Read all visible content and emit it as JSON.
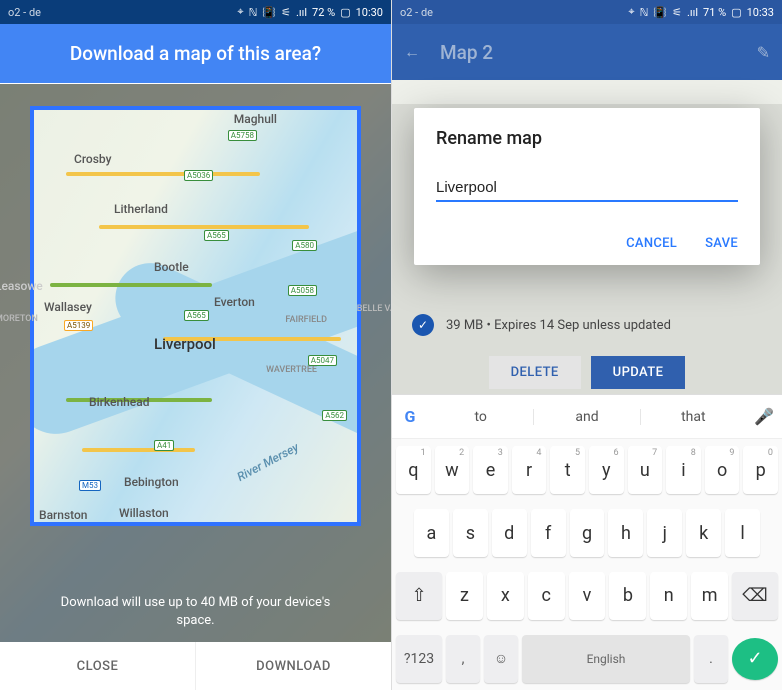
{
  "status": {
    "carrier": "o2 - de",
    "battery_left": "72 %",
    "time_left": "10:30",
    "battery_right": "71 %",
    "time_right": "10:33",
    "signal_text": ".ııl"
  },
  "left": {
    "title": "Download a map of this area?",
    "storage_msg": "Download will use up to 40 MB of your device's space.",
    "close_label": "CLOSE",
    "download_label": "DOWNLOAD",
    "places": {
      "maghull": "Maghull",
      "crosby": "Crosby",
      "litherland": "Litherland",
      "bootle": "Bootle",
      "wallasey": "Wallasey",
      "everton": "Everton",
      "fairfield": "FAIRFIELD",
      "liverpool": "Liverpool",
      "wavertree": "WAVERTREE",
      "birkenhead": "Birkenhead",
      "moreton": "MORETON",
      "bebington": "Bebington",
      "barnston": "Barnston",
      "willaston": "Willaston",
      "mersey": "River Mersey",
      "belleva": "BELLE VA",
      "leasowe": "Leasowe"
    },
    "shields": {
      "a5758": "A5758",
      "a5036": "A5036",
      "a565": "A565",
      "a580": "A580",
      "a5139": "A5139",
      "a565b": "A565",
      "a5058": "A5058",
      "a5047": "A5047",
      "a562": "A562",
      "a41": "A41",
      "m53": "M53"
    }
  },
  "right": {
    "appbar_title": "Map 2",
    "dialog_title": "Rename map",
    "input_value": "Liverpool",
    "cancel_label": "CANCEL",
    "save_label": "SAVE",
    "info_text": "39 MB • Expires 14 Sep unless updated",
    "delete_label": "DELETE",
    "update_label": "UPDATE",
    "suggestions": [
      "to",
      "and",
      "that"
    ],
    "row1": [
      {
        "k": "q",
        "s": "1"
      },
      {
        "k": "w",
        "s": "2"
      },
      {
        "k": "e",
        "s": "3"
      },
      {
        "k": "r",
        "s": "4"
      },
      {
        "k": "t",
        "s": "5"
      },
      {
        "k": "y",
        "s": "6"
      },
      {
        "k": "u",
        "s": "7"
      },
      {
        "k": "i",
        "s": "8"
      },
      {
        "k": "o",
        "s": "9"
      },
      {
        "k": "p",
        "s": "0"
      }
    ],
    "row2": [
      "a",
      "s",
      "d",
      "f",
      "g",
      "h",
      "j",
      "k",
      "l"
    ],
    "row3": [
      "z",
      "x",
      "c",
      "v",
      "b",
      "n",
      "m"
    ],
    "sym_label": "?123",
    "comma": ",",
    "space_label": "English",
    "period": "."
  }
}
